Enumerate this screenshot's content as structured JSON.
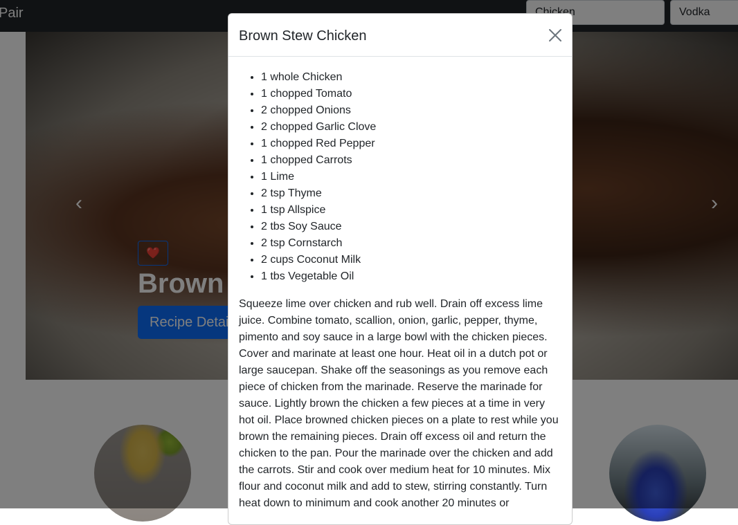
{
  "navbar": {
    "brand": "Pair",
    "food_search_value": "Chicken",
    "drink_search_value": "Vodka"
  },
  "hero": {
    "title": "Brown Stew Chicken",
    "heart": "❤️",
    "details_button": "Recipe Details",
    "prev_icon": "‹",
    "next_icon": "›"
  },
  "modal": {
    "title": "Brown Stew Chicken",
    "ingredients": [
      "1 whole Chicken",
      "1 chopped Tomato",
      "2 chopped Onions",
      "2 chopped Garlic Clove",
      "1 chopped Red Pepper",
      "1 chopped Carrots",
      "1 Lime",
      "2 tsp Thyme",
      "1 tsp Allspice",
      "2 tbs Soy Sauce",
      "2 tsp Cornstarch",
      "2 cups Coconut Milk",
      "1 tbs Vegetable Oil"
    ],
    "instructions": "Squeeze lime over chicken and rub well. Drain off excess lime juice. Combine tomato, scallion, onion, garlic, pepper, thyme, pimento and soy sauce in a large bowl with the chicken pieces. Cover and marinate at least one hour. Heat oil in a dutch pot or large saucepan. Shake off the seasonings as you remove each piece of chicken from the marinade. Reserve the marinade for sauce. Lightly brown the chicken a few pieces at a time in very hot oil. Place browned chicken pieces on a plate to rest while you brown the remaining pieces. Drain off excess oil and return the chicken to the pan. Pour the marinade over the chicken and add the carrots. Stir and cook over medium heat for 10 minutes. Mix flour and coconut milk and add to stew, stirring constantly. Turn heat down to minimum and cook another 20 minutes or"
  },
  "colors": {
    "navbar": "#212529",
    "primary": "#0d6efd",
    "text": "#212529"
  }
}
